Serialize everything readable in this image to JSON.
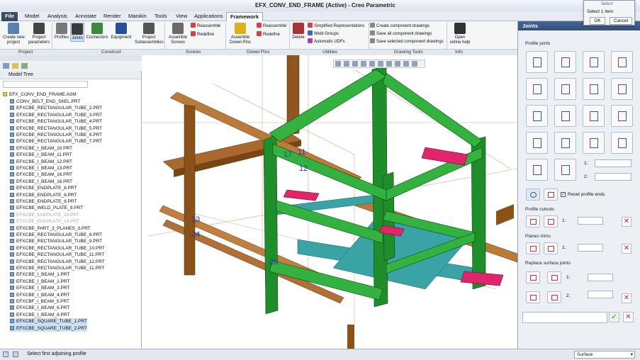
{
  "window": {
    "title": "EFX_CONV_END_FRAME (Active) - Creo Parametric"
  },
  "menu": {
    "file": "File",
    "tabs": [
      "Model",
      "Analysis",
      "Annotate",
      "Render",
      "Manikin",
      "Tools",
      "View",
      "Applications",
      "Framework"
    ]
  },
  "ribbon": {
    "project_new": "Create new\nproject",
    "project_params": "Project\nparameters",
    "profiles": "Profiles",
    "joints": "Joints",
    "connectors": "Connectors",
    "equipment": "Equipment",
    "project_subassemblies": "Project\nSubassemblies",
    "assemble_screws": "Assemble\nScrews",
    "reassemble": "Reassemble",
    "redefine": "Redefine",
    "assemble_dowel": "Assemble\nDowel Pins",
    "reassemble2": "Reassemble",
    "redefine2": "Redefine",
    "delete": "Delete",
    "simplified": "Simplified Representations",
    "weld_groups": "Weld Groups",
    "udfs": "Automatic UDFs",
    "create_drawings": "Create component drawings",
    "save_all": "Save all component drawings",
    "save_selected": "Save selected component drawings",
    "help": "Open\nonline help",
    "groups": {
      "project": "Project",
      "construct": "Construct",
      "screws": "Screws",
      "dowel": "Dowel Pins",
      "utilities": "Utilities",
      "drawing": "Drawing Tools",
      "info": "Info"
    }
  },
  "tree": {
    "header": "Model Tree",
    "root": "EFX_CONV_END_FRAME.ASM",
    "items": [
      "CONV_BELT_END_SKEL.PRT",
      "EFXCBE_RECTANGULAR_TUBE_2.PRT",
      "EFXCBE_RECTANGULAR_TUBE_3.PRT",
      "EFXCBE_RECTANGULAR_TUBE_4.PRT",
      "EFXCBE_RECTANGULAR_TUBE_5.PRT",
      "EFXCBE_RECTANGULAR_TUBE_6.PRT",
      "EFXCBE_RECTANGULAR_TUBE_7.PRT",
      "EFXCBE_I_BEAM_10.PRT",
      "EFXCBE_I_BEAM_11.PRT",
      "EFXCBE_I_BEAM_12.PRT",
      "EFXCBE_I_BEAM_13.PRT",
      "EFXCBE_I_BEAM_16.PRT",
      "EFXCBE_I_BEAM_16.PRT",
      "EFXCBE_ENDPLATE_8.PRT",
      "EFXCBE_ENDPLATE_8.PRT",
      "EFXCBE_ENDPLATE_8.PRT",
      "EFXCBE_WELD_PLATE_9.PRT",
      "EFXCBE_ENDPLATE_14.PRT",
      "EFXCBE_ENDPLATE_14.PRT",
      "EFXCBE_PART_3_PLANES_3.PRT",
      "EFXCBE_RECTANGULAR_TUBE_8.PRT",
      "EFXCBE_RECTANGULAR_TUBE_9.PRT",
      "EFXCBE_RECTANGULAR_TUBE_10.PRT",
      "EFXCBE_RECTANGULAR_TUBE_11.PRT",
      "EFXCBE_RECTANGULAR_TUBE_12.PRT",
      "EFXCBE_RECTANGULAR_TUBE_11.PRT",
      "EFXCBE_I_BEAM_1.PRT",
      "EFXCBE_I_BEAM_2.PRT",
      "EFXCBE_I_BEAM_3.PRT",
      "EFXCBE_I_BEAM_4.PRT",
      "EFXCBF_I_BEAM_5.PRT",
      "EFXCBE_I_BEAM_6.PRT",
      "EFXCBE_I_BEAM_6.PRT",
      "EFXCBE_SQUARE_TUBE_1.PRT",
      "EFXCBE_SQUARE_TUBE_2.PRT"
    ]
  },
  "viewport": {
    "labels": [
      "17",
      "11",
      "12",
      "23",
      "24",
      "26"
    ]
  },
  "panel": {
    "title": "Joints",
    "profile_joints": "Profile joints",
    "reset": "Reset profile ends",
    "cutouts": "Profile cutouts",
    "planes": "Planes trims",
    "replace": "Replace surface joints",
    "d1": "1:",
    "d2": "2:"
  },
  "select": {
    "title": "Select",
    "info": "Select 1 item",
    "ok": "OK",
    "cancel": "Cancel"
  },
  "status": {
    "message": "Select first adjoining profile",
    "filter": "Surface"
  }
}
